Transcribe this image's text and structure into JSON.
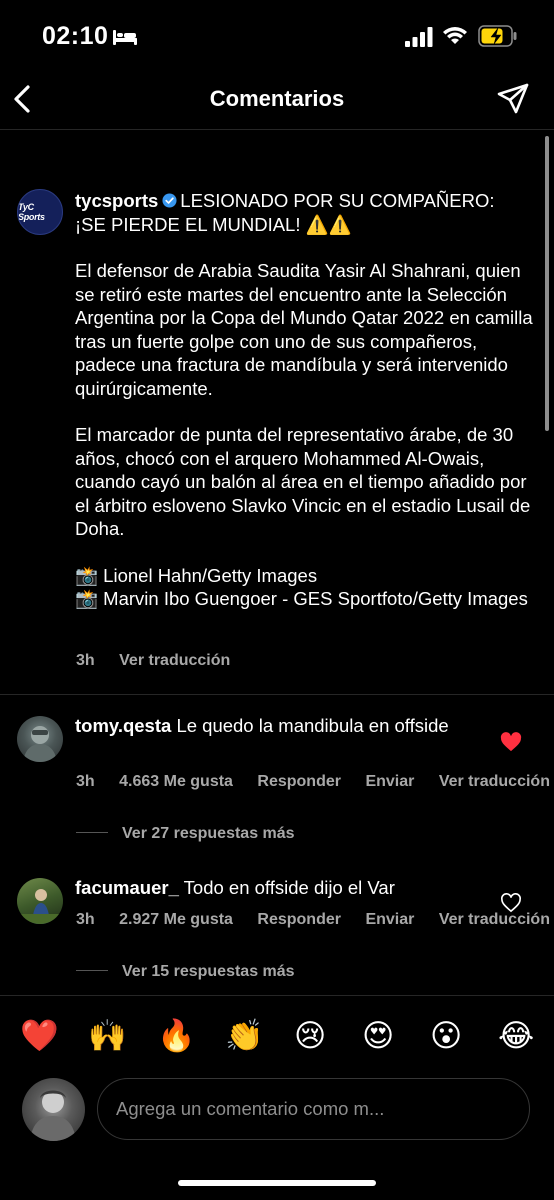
{
  "status_bar": {
    "time": "02:10",
    "icons": [
      "bed-icon",
      "signal-icon",
      "wifi-icon",
      "battery-charging-icon"
    ]
  },
  "nav": {
    "title": "Comentarios",
    "back_icon": "chevron-left-icon",
    "send_icon": "paper-plane-icon"
  },
  "caption": {
    "avatar_logo": "TyC Sports",
    "username": "tycsports",
    "headline_line1": "LESIONADO POR SU COMPAÑERO:",
    "headline_line2": "¡SE PIERDE EL MUNDIAL! ⚠️⚠️",
    "paragraph1": "El defensor de Arabia Saudita Yasir Al Shahrani, quien se retiró este martes del encuentro ante la Selección Argentina por la Copa del Mundo Qatar 2022 en camilla tras un fuerte golpe con uno de sus compañeros, padece una fractura de mandíbula y será intervenido quirúrgicamente.",
    "paragraph2": "El marcador de punta del representativo árabe, de 30 años, chocó con el arquero Mohammed Al-Owais, cuando cayó un balón al área en el tiempo añadido por el árbitro esloveno Slavko Vincic en el estadio Lusail de Doha.",
    "credit1": "📸 Lionel Hahn/Getty Images",
    "credit2": "📸 Marvin Ibo Guengoer - GES Sportfoto/Getty Images",
    "time": "3h",
    "translate": "Ver traducción"
  },
  "comments": [
    {
      "username": "tomy.qesta",
      "text": "Le quedo la mandibula en offside",
      "time": "3h",
      "likes": "4.663 Me gusta",
      "reply": "Responder",
      "send": "Enviar",
      "translate": "Ver traducción",
      "liked": true,
      "replies": "Ver 27 respuestas más"
    },
    {
      "username": "facumauer_",
      "text": "Todo en offside dijo el Var",
      "time": "3h",
      "likes": "2.927 Me gusta",
      "reply": "Responder",
      "send": "Enviar",
      "translate": "Ver traducción",
      "liked": false,
      "replies": "Ver 15 respuestas más"
    }
  ],
  "emoji_bar": [
    "❤️",
    "🙌",
    "🔥",
    "👏",
    "😢",
    "😍",
    "😮",
    "😂"
  ],
  "input": {
    "placeholder": "Agrega un comentario como m..."
  },
  "colors": {
    "background": "#000000",
    "secondary_text": "#a8a8a8",
    "like_red": "#ff3040",
    "verified_blue": "#3897f0",
    "battery_yellow": "#ffd60a"
  }
}
